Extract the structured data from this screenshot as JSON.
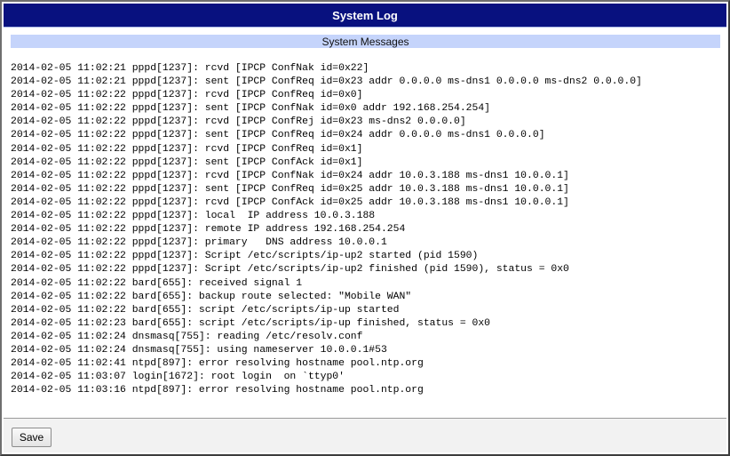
{
  "window": {
    "title": "System Log"
  },
  "section": {
    "header": "System Messages"
  },
  "log": [
    "2014-02-05 11:02:21 pppd[1237]: rcvd [IPCP ConfNak id=0x22]",
    "2014-02-05 11:02:21 pppd[1237]: sent [IPCP ConfReq id=0x23 addr 0.0.0.0 ms-dns1 0.0.0.0 ms-dns2 0.0.0.0]",
    "2014-02-05 11:02:22 pppd[1237]: rcvd [IPCP ConfReq id=0x0]",
    "2014-02-05 11:02:22 pppd[1237]: sent [IPCP ConfNak id=0x0 addr 192.168.254.254]",
    "2014-02-05 11:02:22 pppd[1237]: rcvd [IPCP ConfRej id=0x23 ms-dns2 0.0.0.0]",
    "2014-02-05 11:02:22 pppd[1237]: sent [IPCP ConfReq id=0x24 addr 0.0.0.0 ms-dns1 0.0.0.0]",
    "2014-02-05 11:02:22 pppd[1237]: rcvd [IPCP ConfReq id=0x1]",
    "2014-02-05 11:02:22 pppd[1237]: sent [IPCP ConfAck id=0x1]",
    "2014-02-05 11:02:22 pppd[1237]: rcvd [IPCP ConfNak id=0x24 addr 10.0.3.188 ms-dns1 10.0.0.1]",
    "2014-02-05 11:02:22 pppd[1237]: sent [IPCP ConfReq id=0x25 addr 10.0.3.188 ms-dns1 10.0.0.1]",
    "2014-02-05 11:02:22 pppd[1237]: rcvd [IPCP ConfAck id=0x25 addr 10.0.3.188 ms-dns1 10.0.0.1]",
    "2014-02-05 11:02:22 pppd[1237]: local  IP address 10.0.3.188",
    "2014-02-05 11:02:22 pppd[1237]: remote IP address 192.168.254.254",
    "2014-02-05 11:02:22 pppd[1237]: primary   DNS address 10.0.0.1",
    "2014-02-05 11:02:22 pppd[1237]: Script /etc/scripts/ip-up2 started (pid 1590)",
    "2014-02-05 11:02:22 pppd[1237]: Script /etc/scripts/ip-up2 finished (pid 1590), status = 0x0",
    "2014-02-05 11:02:22 bard[655]: received signal 1",
    "2014-02-05 11:02:22 bard[655]: backup route selected: \"Mobile WAN\"",
    "2014-02-05 11:02:22 bard[655]: script /etc/scripts/ip-up started",
    "2014-02-05 11:02:23 bard[655]: script /etc/scripts/ip-up finished, status = 0x0",
    "2014-02-05 11:02:24 dnsmasq[755]: reading /etc/resolv.conf",
    "2014-02-05 11:02:24 dnsmasq[755]: using nameserver 10.0.0.1#53",
    "2014-02-05 11:02:41 ntpd[897]: error resolving hostname pool.ntp.org",
    "2014-02-05 11:03:07 login[1672]: root login  on `ttyp0'",
    "2014-02-05 11:03:16 ntpd[897]: error resolving hostname pool.ntp.org"
  ],
  "footer": {
    "save_label": "Save"
  },
  "colors": {
    "titlebar": "#08117f",
    "section_header": "#c5d4fb"
  }
}
